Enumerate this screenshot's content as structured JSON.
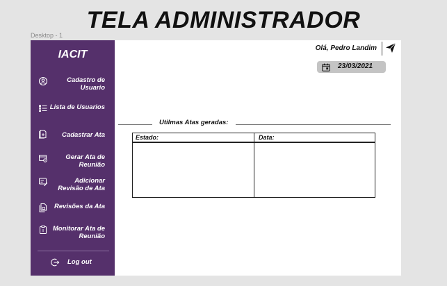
{
  "banner_title": "TELA ADMINISTRADOR",
  "frame_label": "Desktop - 1",
  "sidebar": {
    "logo": "IACIT",
    "items": [
      {
        "label": "Cadastro de Usuario",
        "icon": "user-circle-icon"
      },
      {
        "label": "Lista de Usuarios",
        "icon": "list-icon"
      },
      {
        "label": "Cadastrar Ata",
        "icon": "document-add-icon"
      },
      {
        "label": "Gerar Ata de Reunião",
        "icon": "generate-document-icon"
      },
      {
        "label": "Adicionar Revisão de Ata",
        "icon": "edit-document-icon"
      },
      {
        "label": "Revisões da Ata",
        "icon": "documents-icon"
      },
      {
        "label": "Monitorar Ata de Reunião",
        "icon": "clipboard-icon"
      }
    ],
    "logout_label": "Log out"
  },
  "header": {
    "greeting": "Olá, Pedro Landim",
    "date": "23/03/2021"
  },
  "main": {
    "section_title": "Utilmas Atas geradas:",
    "table": {
      "columns": [
        "Estado:",
        "Data:"
      ],
      "rows": []
    }
  },
  "colors": {
    "sidebar": "#55306b",
    "page_background": "#e4e4e4",
    "content_background": "#ffffff",
    "date_pill": "#c4c4c4"
  }
}
